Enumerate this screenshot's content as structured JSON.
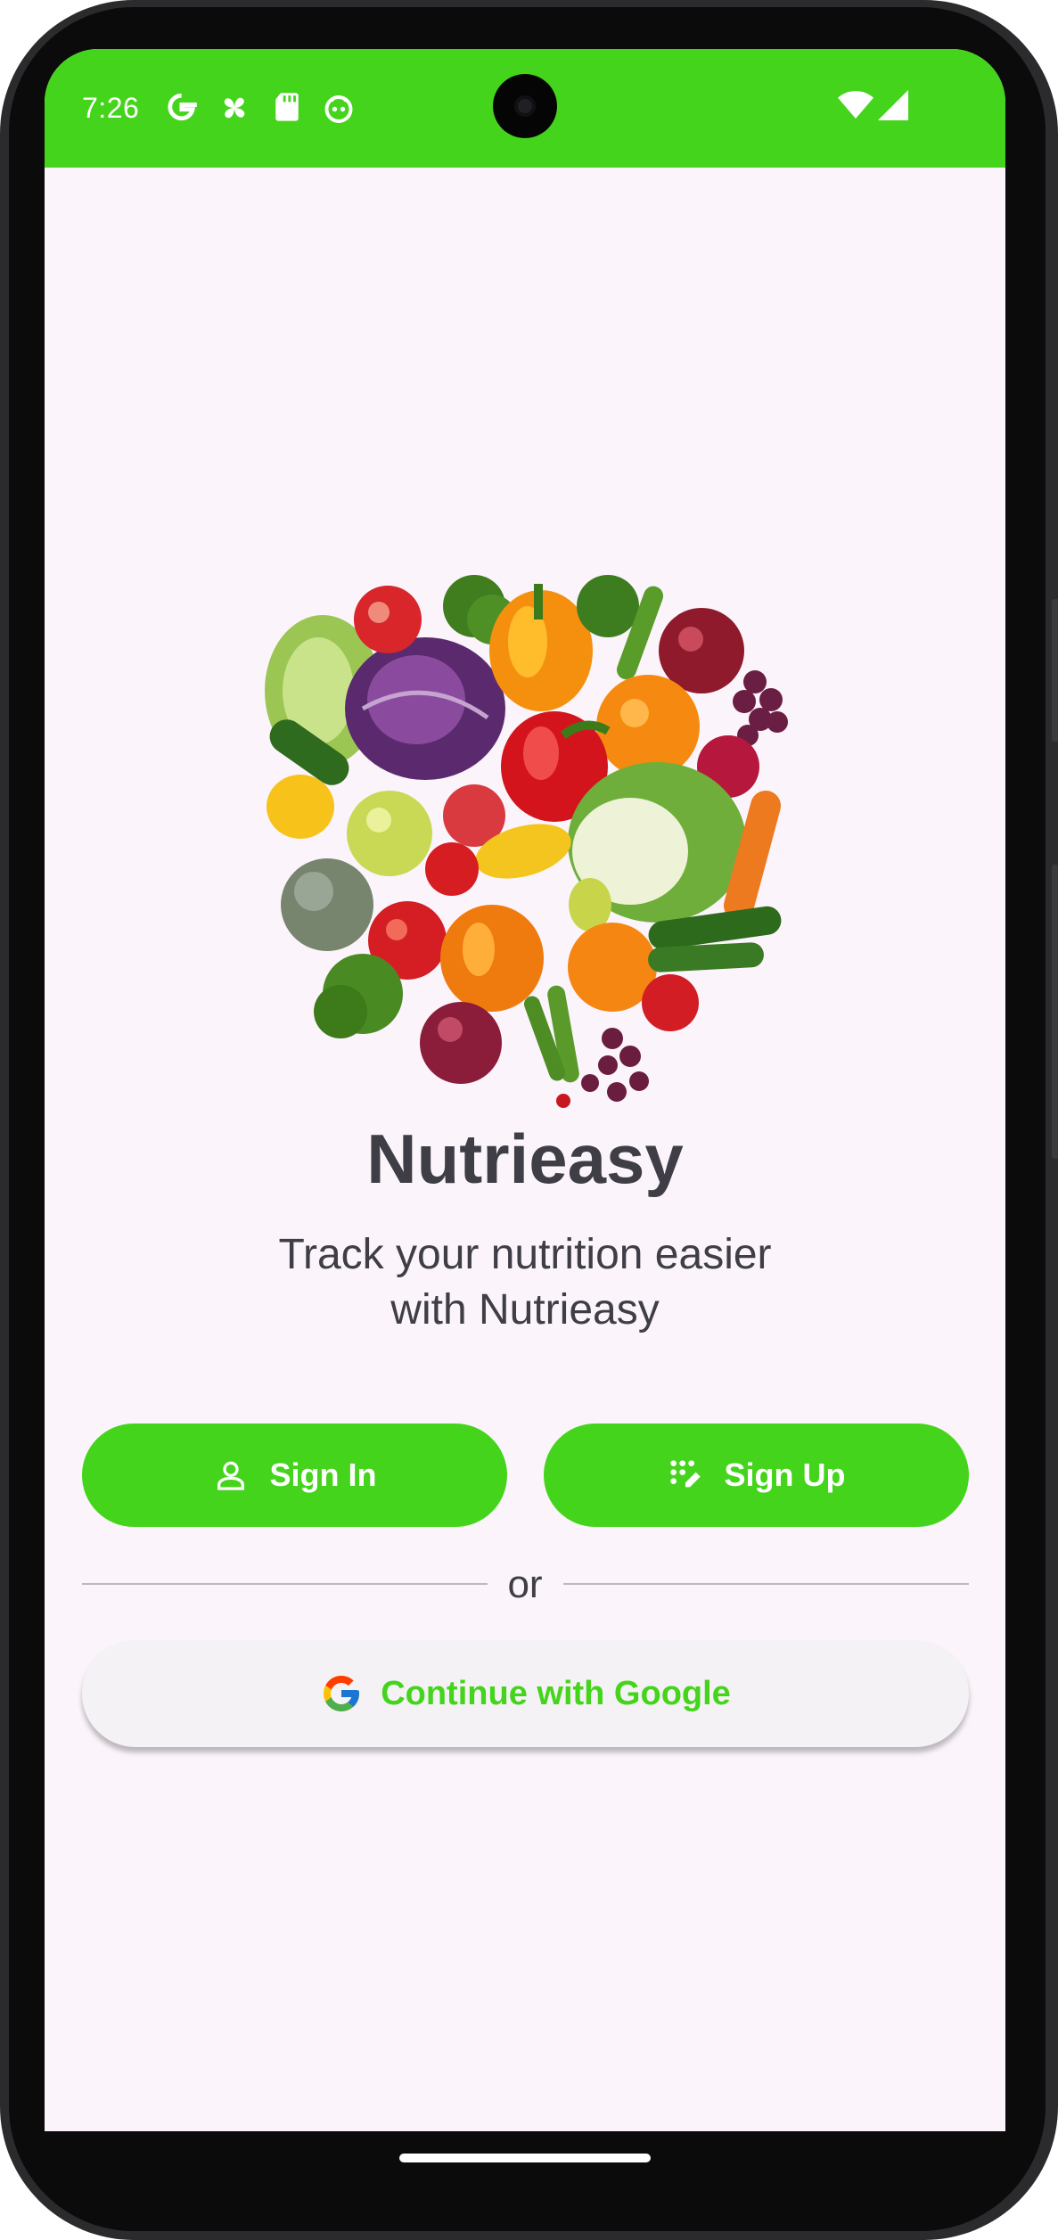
{
  "status_bar": {
    "time": "7:26",
    "icons": [
      "google-g-icon",
      "pinwheel-icon",
      "sd-card-icon",
      "android-face-icon"
    ],
    "right_icons": [
      "wifi-icon",
      "cellular-signal-icon"
    ],
    "color": "#45d41c"
  },
  "hero_image": {
    "description_icon": "vegetables-illustration"
  },
  "app": {
    "title": "Nutrieasy",
    "tagline_line1": "Track your nutrition easier",
    "tagline_line2": "with Nutrieasy"
  },
  "buttons": {
    "sign_in": "Sign In",
    "sign_up": "Sign Up",
    "divider_text": "or",
    "google": "Continue with Google"
  },
  "colors": {
    "accent": "#45d41c",
    "background": "#fbf4fb",
    "text": "#3f3e46"
  }
}
